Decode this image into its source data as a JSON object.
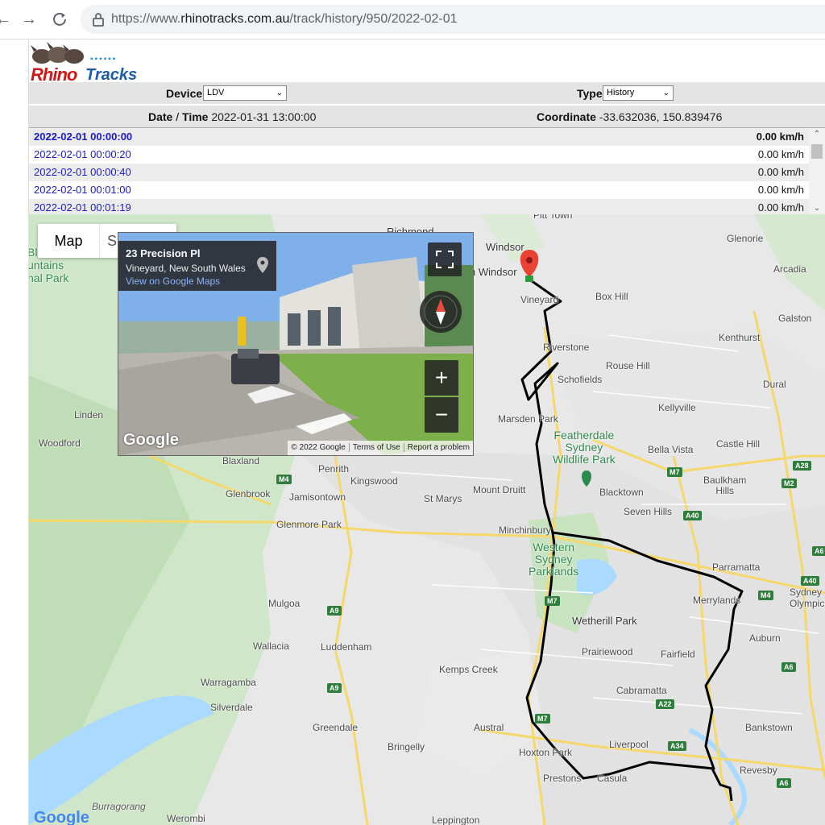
{
  "browser": {
    "url_prefix": "https://www.",
    "url_domain": "rhinotracks.com.au",
    "url_path": "/track/history/950/2022-02-01"
  },
  "logo": {
    "text_rhino": "Rhino",
    "text_tracks": "Tracks"
  },
  "controls": {
    "device_label": "Device",
    "device_value": "LDV",
    "type_label": "Type",
    "type_value": "History",
    "datetime_label_a": "Date",
    "datetime_label_b": "Time",
    "datetime_value": "2022-01-31 13:00:00",
    "coordinate_label": "Coordinate",
    "coordinate_value": "-33.632036, 150.839476"
  },
  "history": [
    {
      "time": "2022-02-01 00:00:00",
      "speed": "0.00 km/h",
      "selected": true
    },
    {
      "time": "2022-02-01 00:00:20",
      "speed": "0.00 km/h"
    },
    {
      "time": "2022-02-01 00:00:40",
      "speed": "0.00 km/h"
    },
    {
      "time": "2022-02-01 00:01:00",
      "speed": "0.00 km/h"
    },
    {
      "time": "2022-02-01 00:01:19",
      "speed": "0.00 km/h"
    }
  ],
  "map": {
    "type_map": "Map",
    "type_satellite": "S",
    "google": "Google",
    "places": {
      "pitt_town": "Pitt Town",
      "richmond": "Richmond",
      "windsor": "Windsor",
      "south_windsor": "h Windsor",
      "vineyard": "Vineyard",
      "box_hill": "Box Hill",
      "glenorie": "Glenorie",
      "arcadia": "Arcadia",
      "galston": "Galston",
      "kenthurst": "Kenthurst",
      "riverstone": "Riverstone",
      "rouse_hill": "Rouse Hill",
      "schofields": "Schofields",
      "dural": "Dural",
      "kellyville": "Kellyville",
      "marsden_park": "Marsden Park",
      "featherdale": "Featherdale\nSydney\nWildlife Park",
      "bella_vista": "Bella Vista",
      "castle_hill": "Castle Hill",
      "linden": "Linden",
      "woodford": "Woodford",
      "blaxland": "Blaxland",
      "penrith": "Penrith",
      "kingswood": "Kingswood",
      "glenbrook": "Glenbrook",
      "jamisontown": "Jamisontown",
      "st_marys": "St Marys",
      "mount_druitt": "Mount Druitt",
      "blacktown": "Blacktown",
      "baulkham_hills": "Baulkham\nHills",
      "seven_hills": "Seven Hills",
      "glenmore_park": "Glenmore Park",
      "minchinbury": "Minchinbury",
      "western_sydney": "Western\nSydney\nParklands",
      "parramatta": "Parramatta",
      "mulgoa": "Mulgoa",
      "merrylands": "Merrylands",
      "sydney_olympic": "Sydney\nOlympic",
      "wetherill_park": "Wetherill Park",
      "wallacia": "Wallacia",
      "luddenham": "Luddenham",
      "prairiewood": "Prairiewood",
      "fairfield": "Fairfield",
      "auburn": "Auburn",
      "kemps_creek": "Kemps Creek",
      "warragamba": "Warragamba",
      "cabramatta": "Cabramatta",
      "silverdale": "Silverdale",
      "greendale": "Greendale",
      "austral": "Austral",
      "bankstown": "Bankstown",
      "bringelly": "Bringelly",
      "liverpool": "Liverpool",
      "hoxton_park": "Hoxton Park",
      "prestons": "Prestons",
      "casula": "Casula",
      "revesby": "Revesby",
      "burragorang": "Burragorang",
      "werombi": "Werombi",
      "leppington": "Leppington",
      "blue_mtns_a": "Bl",
      "blue_mtns_b": "untains",
      "blue_mtns_c": "nal Park"
    },
    "shields": {
      "m7a": "M7",
      "m7b": "M7",
      "m7c": "M7",
      "m4a": "M4",
      "m4b": "M4",
      "a28": "A28",
      "m2": "M2",
      "a40a": "A40",
      "a40b": "A40",
      "a9a": "A9",
      "a9b": "A9",
      "a22": "A22",
      "a34a": "A34",
      "a6a": "A6",
      "a6b": "A6",
      "a6c": "A6"
    },
    "streetview": {
      "address": "23 Precision Pl",
      "locality": "Vineyard, New South Wales",
      "link": "View on Google Maps",
      "footer_copy": "© 2022 Google",
      "footer_terms": "Terms of Use",
      "footer_report": "Report a problem",
      "logo": "Google"
    }
  }
}
